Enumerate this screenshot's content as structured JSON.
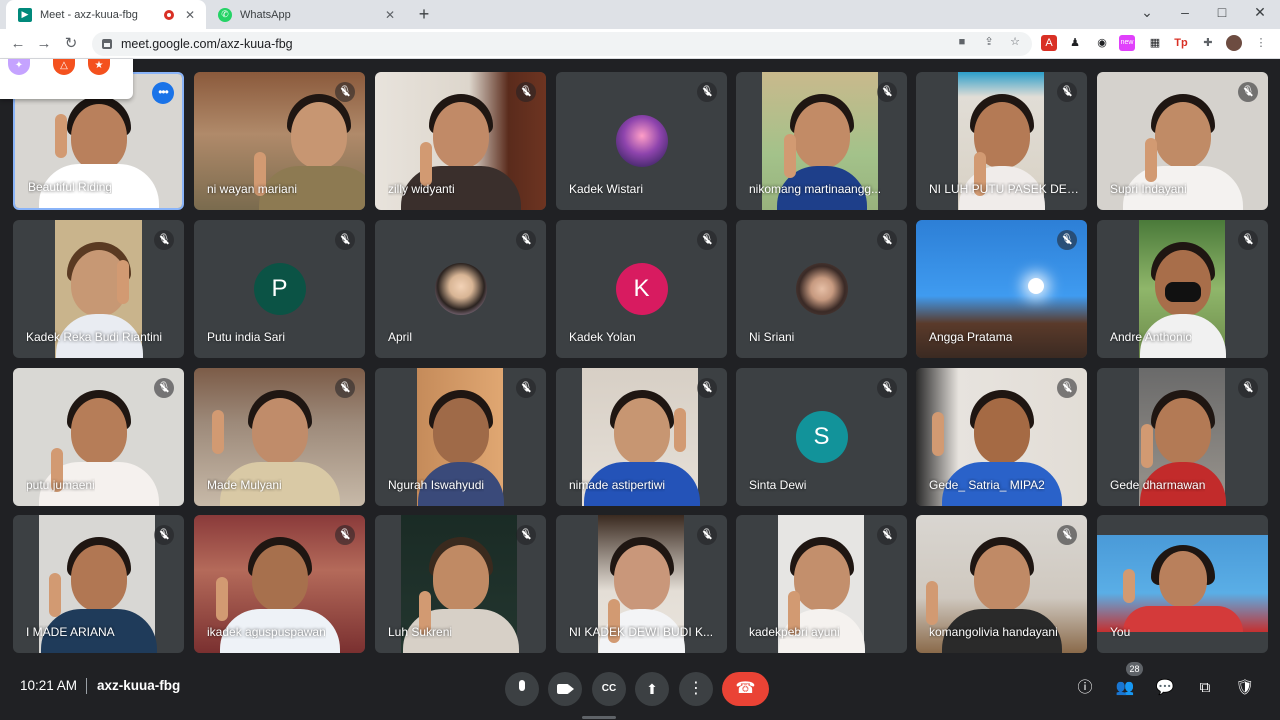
{
  "browser": {
    "tabs": [
      {
        "title": "Meet - axz-kuua-fbg",
        "close": "✕"
      },
      {
        "title": "WhatsApp",
        "close": "✕"
      }
    ],
    "new_tab": "+",
    "window_controls": {
      "minimize": "–",
      "maximize": "□",
      "close": "✕",
      "tab_search": "⌄"
    },
    "url": "meet.google.com/axz-kuua-fbg"
  },
  "meeting": {
    "time": "10:21 AM",
    "code": "axz-kuua-fbg",
    "participant_count": "28"
  },
  "participants": [
    {
      "name": "Beautiful Riding",
      "type": "video",
      "muted": false,
      "speaking": true
    },
    {
      "name": "ni wayan mariani",
      "type": "video",
      "muted": true
    },
    {
      "name": "zilly widyanti",
      "type": "video",
      "muted": true
    },
    {
      "name": "Kadek Wistari",
      "type": "photo",
      "muted": true
    },
    {
      "name": "nikomang martinaangg...",
      "type": "video",
      "muted": true
    },
    {
      "name": "NI LUH PUTU PASEK DEV...",
      "type": "video",
      "muted": true
    },
    {
      "name": "Supri Indayani",
      "type": "video",
      "muted": true
    },
    {
      "name": "Kadek Reka Budi Riantini",
      "type": "video",
      "muted": true
    },
    {
      "name": "Putu india Sari",
      "type": "letter",
      "letter": "P",
      "color": "#0b5345",
      "muted": true
    },
    {
      "name": "April",
      "type": "photo",
      "muted": true
    },
    {
      "name": "Kadek Yolan",
      "type": "letter",
      "letter": "K",
      "color": "#d81b60",
      "muted": true
    },
    {
      "name": "Ni Sriani",
      "type": "photo",
      "muted": true
    },
    {
      "name": "Angga Pratama",
      "type": "video",
      "muted": true
    },
    {
      "name": "Andre Anthonio",
      "type": "video",
      "muted": true
    },
    {
      "name": "putu jumaeni",
      "type": "video",
      "muted": true
    },
    {
      "name": "Made Mulyani",
      "type": "video",
      "muted": true
    },
    {
      "name": "Ngurah Iswahyudi",
      "type": "video",
      "muted": true
    },
    {
      "name": "nimade astipertiwi",
      "type": "video",
      "muted": true
    },
    {
      "name": "Sinta Dewi",
      "type": "letter",
      "letter": "S",
      "color": "#12939a",
      "muted": true
    },
    {
      "name": "Gede_ Satria_ MIPA2",
      "type": "video",
      "muted": true
    },
    {
      "name": "Gede dharmawan",
      "type": "video",
      "muted": true
    },
    {
      "name": "I MADE ARIANA",
      "type": "video",
      "muted": true
    },
    {
      "name": "ikadek aguspuspawan",
      "type": "video",
      "muted": true
    },
    {
      "name": "Luh Sukreni",
      "type": "video",
      "muted": true
    },
    {
      "name": "NI KADEK DEWI BUDI K...",
      "type": "video",
      "muted": true
    },
    {
      "name": "kadekpebri ayuni",
      "type": "video",
      "muted": true
    },
    {
      "name": "komangolivia handayani",
      "type": "video",
      "muted": true
    },
    {
      "name": "You",
      "type": "video",
      "muted": false
    }
  ],
  "colors": {
    "accent": "#8ab4f8",
    "end_call": "#ea4335",
    "background": "#202124",
    "tile": "#3c4043"
  }
}
